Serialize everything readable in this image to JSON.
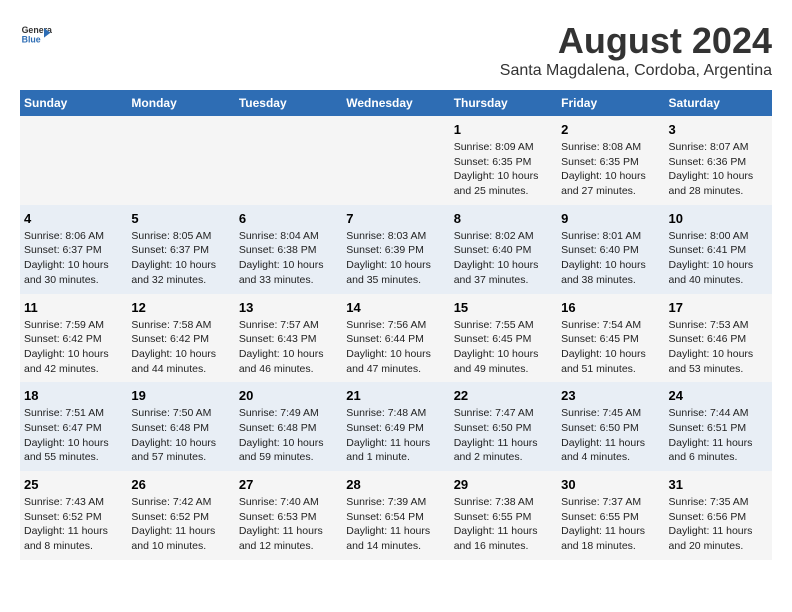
{
  "logo": {
    "line1": "General",
    "line2": "Blue"
  },
  "title": "August 2024",
  "subtitle": "Santa Magdalena, Cordoba, Argentina",
  "days_of_week": [
    "Sunday",
    "Monday",
    "Tuesday",
    "Wednesday",
    "Thursday",
    "Friday",
    "Saturday"
  ],
  "weeks": [
    [
      {
        "day": "",
        "info": ""
      },
      {
        "day": "",
        "info": ""
      },
      {
        "day": "",
        "info": ""
      },
      {
        "day": "",
        "info": ""
      },
      {
        "day": "1",
        "info": "Sunrise: 8:09 AM\nSunset: 6:35 PM\nDaylight: 10 hours\nand 25 minutes."
      },
      {
        "day": "2",
        "info": "Sunrise: 8:08 AM\nSunset: 6:35 PM\nDaylight: 10 hours\nand 27 minutes."
      },
      {
        "day": "3",
        "info": "Sunrise: 8:07 AM\nSunset: 6:36 PM\nDaylight: 10 hours\nand 28 minutes."
      }
    ],
    [
      {
        "day": "4",
        "info": "Sunrise: 8:06 AM\nSunset: 6:37 PM\nDaylight: 10 hours\nand 30 minutes."
      },
      {
        "day": "5",
        "info": "Sunrise: 8:05 AM\nSunset: 6:37 PM\nDaylight: 10 hours\nand 32 minutes."
      },
      {
        "day": "6",
        "info": "Sunrise: 8:04 AM\nSunset: 6:38 PM\nDaylight: 10 hours\nand 33 minutes."
      },
      {
        "day": "7",
        "info": "Sunrise: 8:03 AM\nSunset: 6:39 PM\nDaylight: 10 hours\nand 35 minutes."
      },
      {
        "day": "8",
        "info": "Sunrise: 8:02 AM\nSunset: 6:40 PM\nDaylight: 10 hours\nand 37 minutes."
      },
      {
        "day": "9",
        "info": "Sunrise: 8:01 AM\nSunset: 6:40 PM\nDaylight: 10 hours\nand 38 minutes."
      },
      {
        "day": "10",
        "info": "Sunrise: 8:00 AM\nSunset: 6:41 PM\nDaylight: 10 hours\nand 40 minutes."
      }
    ],
    [
      {
        "day": "11",
        "info": "Sunrise: 7:59 AM\nSunset: 6:42 PM\nDaylight: 10 hours\nand 42 minutes."
      },
      {
        "day": "12",
        "info": "Sunrise: 7:58 AM\nSunset: 6:42 PM\nDaylight: 10 hours\nand 44 minutes."
      },
      {
        "day": "13",
        "info": "Sunrise: 7:57 AM\nSunset: 6:43 PM\nDaylight: 10 hours\nand 46 minutes."
      },
      {
        "day": "14",
        "info": "Sunrise: 7:56 AM\nSunset: 6:44 PM\nDaylight: 10 hours\nand 47 minutes."
      },
      {
        "day": "15",
        "info": "Sunrise: 7:55 AM\nSunset: 6:45 PM\nDaylight: 10 hours\nand 49 minutes."
      },
      {
        "day": "16",
        "info": "Sunrise: 7:54 AM\nSunset: 6:45 PM\nDaylight: 10 hours\nand 51 minutes."
      },
      {
        "day": "17",
        "info": "Sunrise: 7:53 AM\nSunset: 6:46 PM\nDaylight: 10 hours\nand 53 minutes."
      }
    ],
    [
      {
        "day": "18",
        "info": "Sunrise: 7:51 AM\nSunset: 6:47 PM\nDaylight: 10 hours\nand 55 minutes."
      },
      {
        "day": "19",
        "info": "Sunrise: 7:50 AM\nSunset: 6:48 PM\nDaylight: 10 hours\nand 57 minutes."
      },
      {
        "day": "20",
        "info": "Sunrise: 7:49 AM\nSunset: 6:48 PM\nDaylight: 10 hours\nand 59 minutes."
      },
      {
        "day": "21",
        "info": "Sunrise: 7:48 AM\nSunset: 6:49 PM\nDaylight: 11 hours\nand 1 minute."
      },
      {
        "day": "22",
        "info": "Sunrise: 7:47 AM\nSunset: 6:50 PM\nDaylight: 11 hours\nand 2 minutes."
      },
      {
        "day": "23",
        "info": "Sunrise: 7:45 AM\nSunset: 6:50 PM\nDaylight: 11 hours\nand 4 minutes."
      },
      {
        "day": "24",
        "info": "Sunrise: 7:44 AM\nSunset: 6:51 PM\nDaylight: 11 hours\nand 6 minutes."
      }
    ],
    [
      {
        "day": "25",
        "info": "Sunrise: 7:43 AM\nSunset: 6:52 PM\nDaylight: 11 hours\nand 8 minutes."
      },
      {
        "day": "26",
        "info": "Sunrise: 7:42 AM\nSunset: 6:52 PM\nDaylight: 11 hours\nand 10 minutes."
      },
      {
        "day": "27",
        "info": "Sunrise: 7:40 AM\nSunset: 6:53 PM\nDaylight: 11 hours\nand 12 minutes."
      },
      {
        "day": "28",
        "info": "Sunrise: 7:39 AM\nSunset: 6:54 PM\nDaylight: 11 hours\nand 14 minutes."
      },
      {
        "day": "29",
        "info": "Sunrise: 7:38 AM\nSunset: 6:55 PM\nDaylight: 11 hours\nand 16 minutes."
      },
      {
        "day": "30",
        "info": "Sunrise: 7:37 AM\nSunset: 6:55 PM\nDaylight: 11 hours\nand 18 minutes."
      },
      {
        "day": "31",
        "info": "Sunrise: 7:35 AM\nSunset: 6:56 PM\nDaylight: 11 hours\nand 20 minutes."
      }
    ]
  ]
}
